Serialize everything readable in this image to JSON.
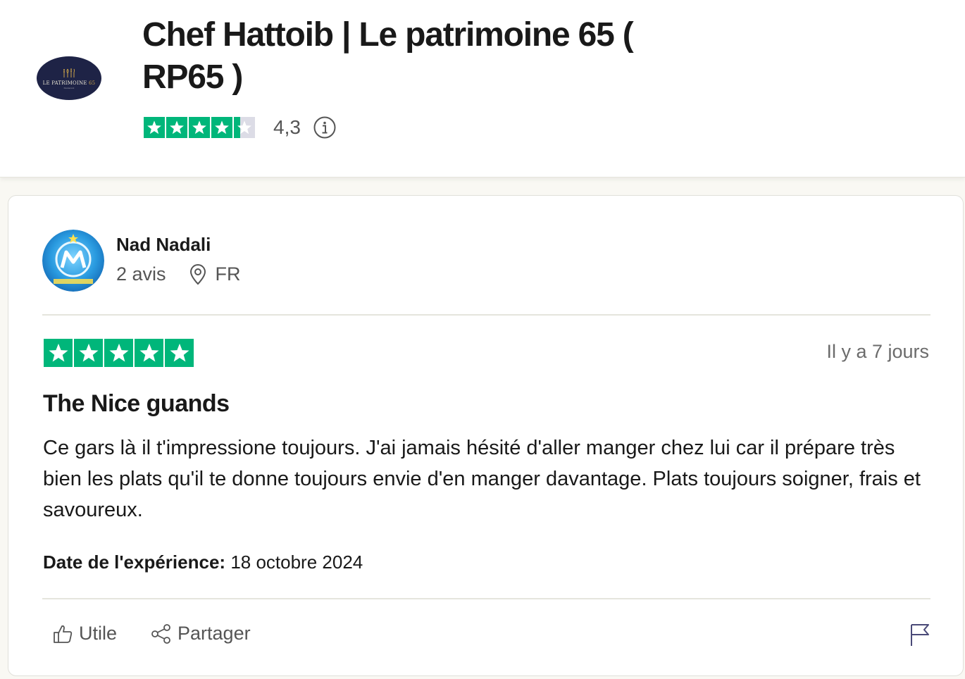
{
  "business": {
    "title": "Chef Hattoib | Le patrimoine 65 ( RP65 )",
    "logo_text_main": "LE PATRIMOINE",
    "logo_text_num": "65",
    "logo_subtext": "Restaurant",
    "trust_score": "4,3",
    "stars_filled": 4.3,
    "info_icon": "info-icon"
  },
  "review": {
    "reviewer_name": "Nad Nadali",
    "review_count": "2 avis",
    "country": "FR",
    "rating": 5,
    "posted": "Il y a 7 jours",
    "title": "The Nice guands",
    "body": "Ce gars là il t'impressione toujours. J'ai jamais hésité d'aller manger chez lui car il prépare très bien les plats qu'il te donne toujours envie d'en manger davantage. Plats toujours soigner, frais et savoureux.",
    "experience_label": "Date de l'expérience:",
    "experience_date": "18 octobre 2024"
  },
  "actions": {
    "useful_label": "Utile",
    "share_label": "Partager",
    "report_icon": "flag-icon"
  },
  "colors": {
    "brand_green": "#00b67a",
    "empty_star": "#dcdce6",
    "logo_bg": "#1e2346",
    "text_primary": "#191919",
    "text_secondary": "#555555"
  }
}
